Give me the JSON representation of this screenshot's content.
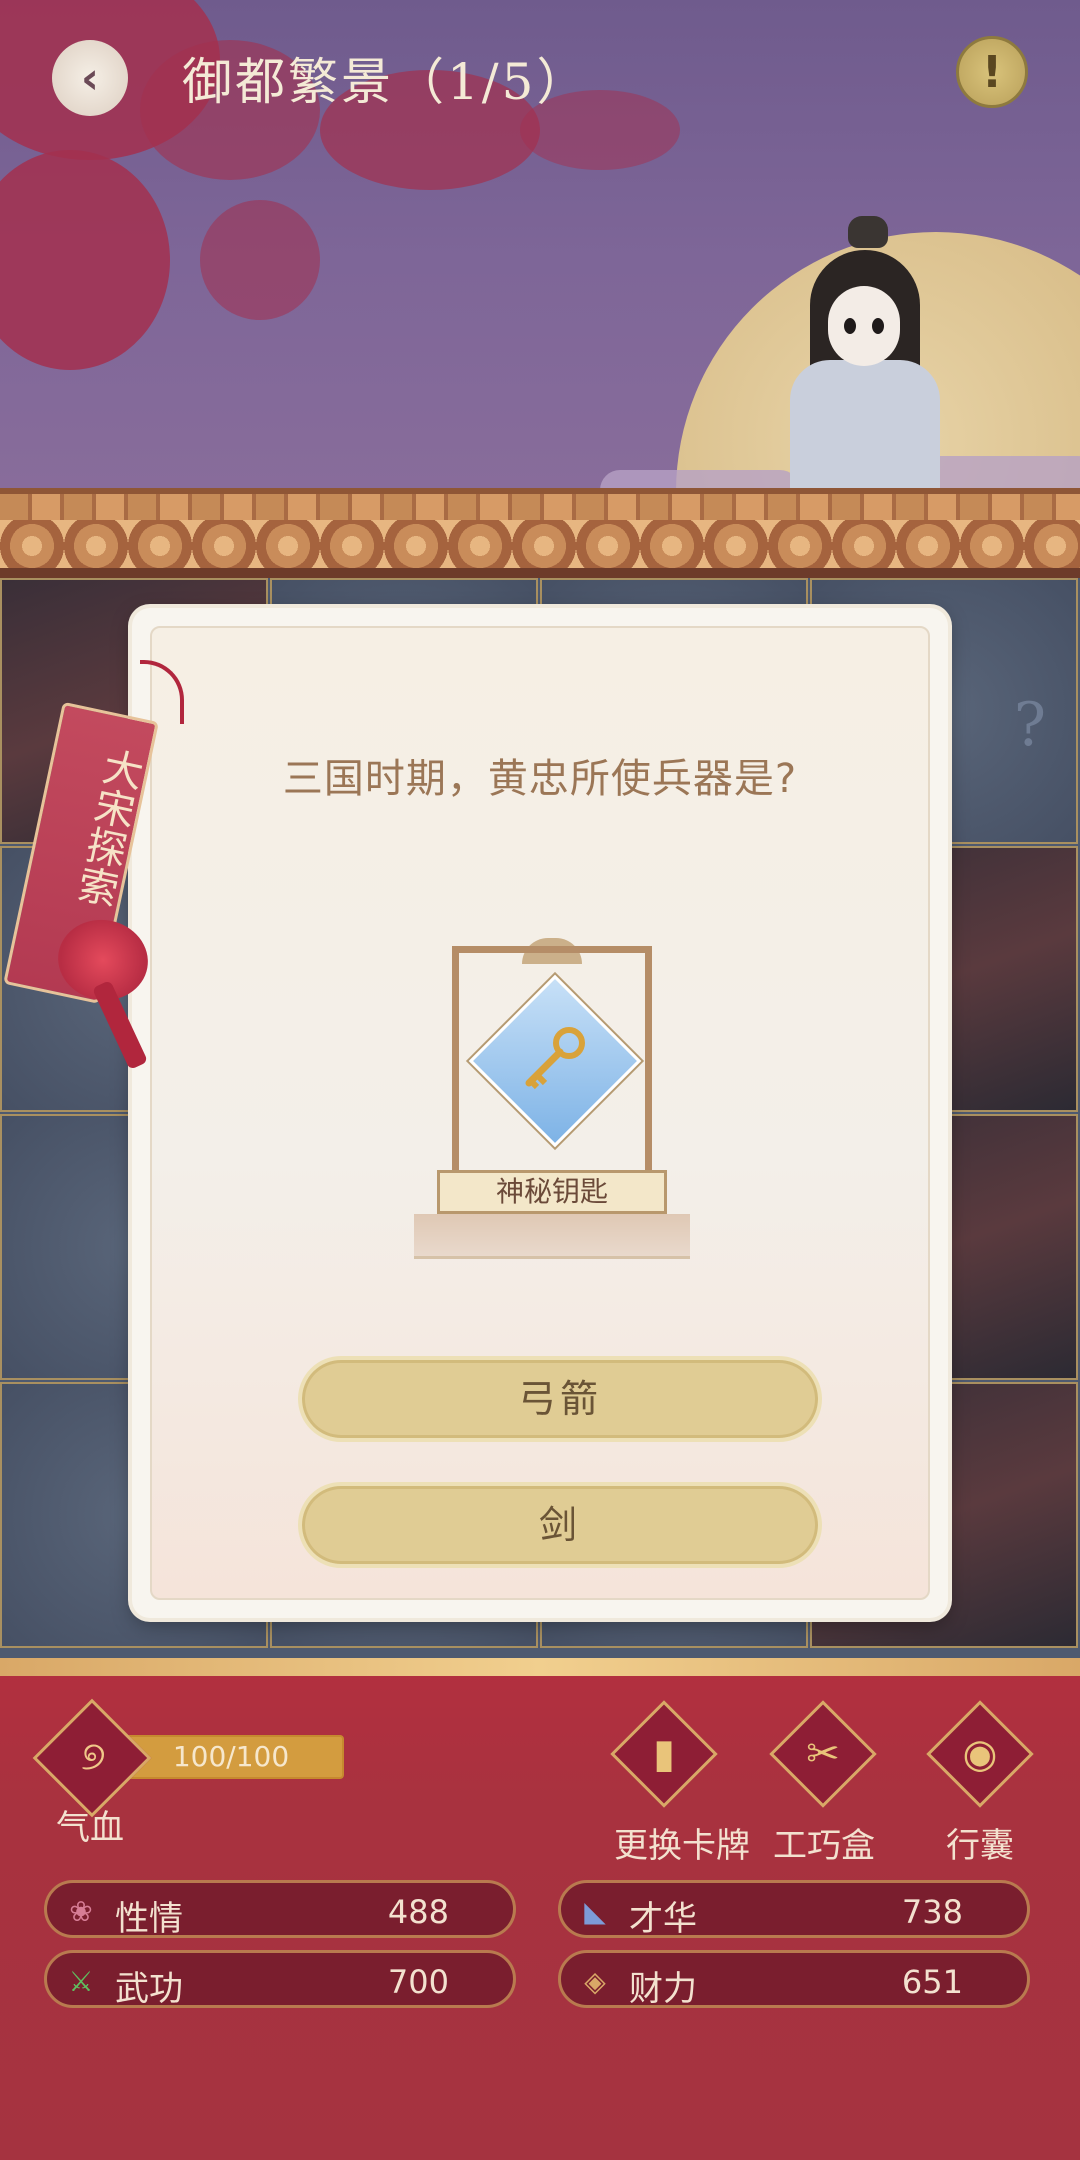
{
  "header": {
    "title": "御都繁景（1/5）",
    "back_icon": "back-arrow-icon",
    "info_icon": "exclamation-icon"
  },
  "grid": {
    "hidden_mark": "?"
  },
  "card": {
    "tag_text": "大宋探索",
    "question": "三国时期，黄忠所使兵器是?",
    "reward_name": "神秘钥匙",
    "reward_icon": "key-icon",
    "answers": [
      "弓箭",
      "剑"
    ]
  },
  "status": {
    "hp_label": "气血",
    "hp_value": "100/100",
    "hp_fraction": 1.0
  },
  "tools": [
    {
      "label": "更换卡牌",
      "icon": "card-swap-icon"
    },
    {
      "label": "工巧盒",
      "icon": "scissors-icon"
    },
    {
      "label": "行囊",
      "icon": "bag-icon"
    }
  ],
  "stats": [
    {
      "name": "性情",
      "value": "488",
      "icon": "flower-icon",
      "color": "#d77d96"
    },
    {
      "name": "才华",
      "value": "738",
      "icon": "fan-icon",
      "color": "#7d9bd7"
    },
    {
      "name": "武功",
      "value": "700",
      "icon": "sword-icon",
      "color": "#5fbf5f"
    },
    {
      "name": "财力",
      "value": "651",
      "icon": "coin-icon",
      "color": "#d9a867"
    }
  ],
  "colors": {
    "panel_red": "#a8323f",
    "gold": "#d9a867",
    "answer_fill": "#e0cc94"
  }
}
